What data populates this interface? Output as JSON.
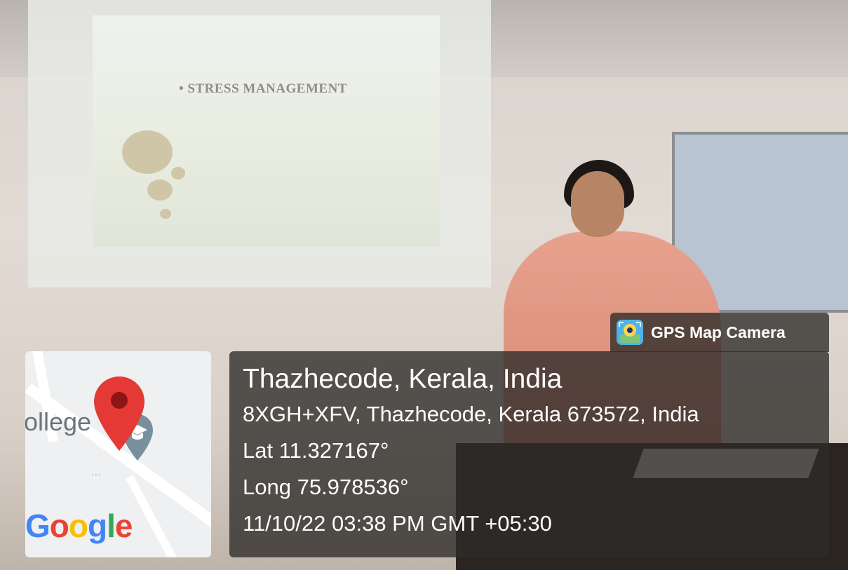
{
  "slide": {
    "title": "• STRESS MANAGEMENT"
  },
  "badge": {
    "label": "GPS Map Camera",
    "icon": "gps-camera-icon"
  },
  "map": {
    "place_label": "ollege",
    "dots": "...",
    "brand": {
      "g1": "G",
      "o1": "o",
      "o2": "o",
      "g2": "g",
      "l": "l",
      "e": "e"
    },
    "pin_color": "#e53935",
    "edu_pin_color": "#78909c"
  },
  "location": {
    "place": "Thazhecode, Kerala, India",
    "address": "8XGH+XFV, Thazhecode, Kerala 673572, India",
    "lat": "Lat 11.327167°",
    "long": "Long 75.978536°",
    "datetime": "11/10/22 03:38 PM GMT +05:30"
  }
}
